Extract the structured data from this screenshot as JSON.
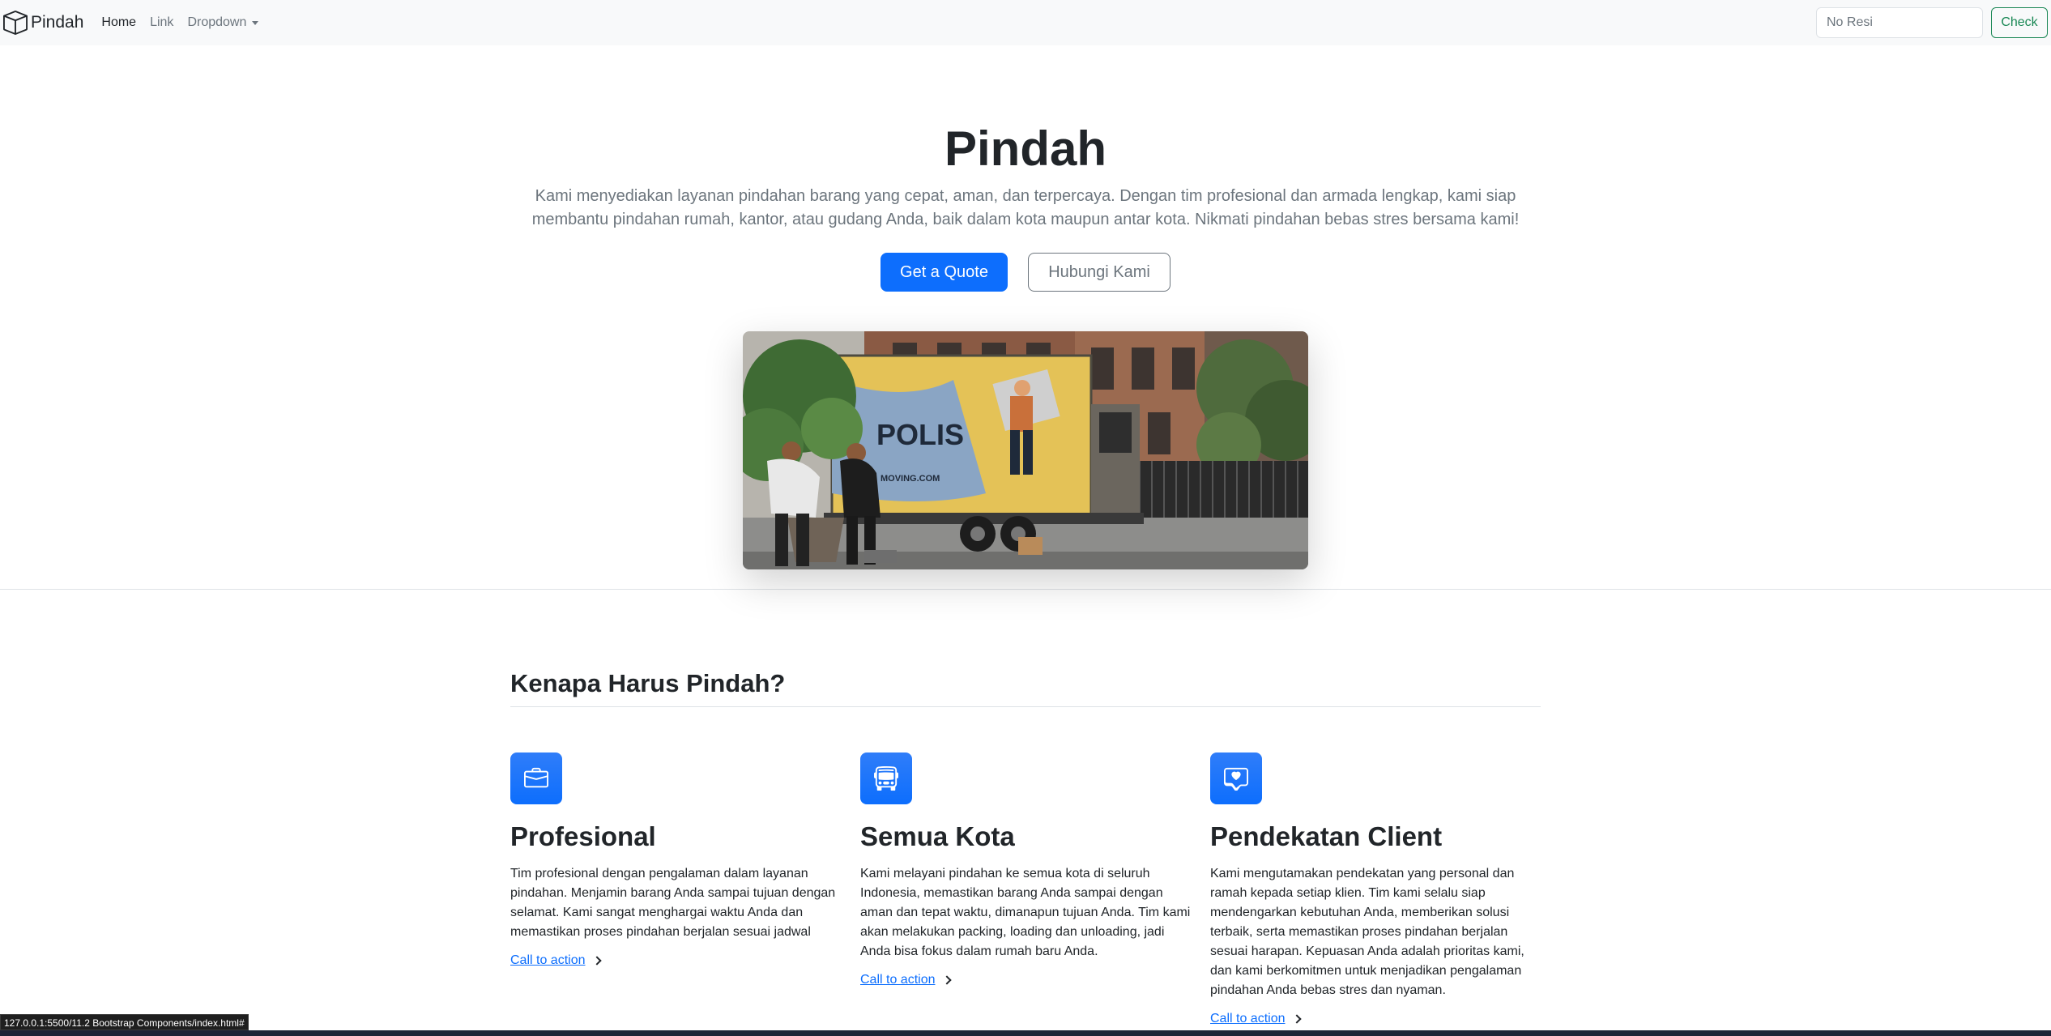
{
  "navbar": {
    "brand": "Pindah",
    "links": [
      "Home",
      "Link",
      "Dropdown"
    ],
    "search_placeholder": "No Resi",
    "check_label": "Check"
  },
  "hero": {
    "title": "Pindah",
    "lead": "Kami menyediakan layanan pindahan barang yang cepat, aman, dan terpercaya. Dengan tim profesional dan armada lengkap, kami siap membantu pindahan rumah, kantor, atau gudang Anda, baik dalam kota maupun antar kota. Nikmati pindahan bebas stres bersama kami!",
    "primary_button": "Get a Quote",
    "secondary_button": "Hubungi Kami",
    "truck_text": "POLIS",
    "truck_text_small": "MOVING.COM"
  },
  "features": {
    "title": "Kenapa Harus Pindah?",
    "items": [
      {
        "icon": "briefcase-icon",
        "title": "Profesional",
        "text": "Tim profesional dengan pengalaman dalam layanan pindahan. Menjamin barang Anda sampai tujuan dengan selamat. Kami sangat menghargai waktu Anda dan memastikan proses pindahan berjalan sesuai jadwal",
        "link": "Call to action"
      },
      {
        "icon": "bus-icon",
        "title": "Semua Kota",
        "text": "Kami melayani pindahan ke semua kota di seluruh Indonesia, memastikan barang Anda sampai dengan aman dan tepat waktu, dimanapun tujuan Anda. Tim kami akan melakukan packing, loading dan unloading, jadi Anda bisa fokus dalam rumah baru Anda.",
        "link": "Call to action"
      },
      {
        "icon": "chat-heart-icon",
        "title": "Pendekatan Client",
        "text": "Kami mengutamakan pendekatan yang personal dan ramah kepada setiap klien. Tim kami selalu siap mendengarkan kebutuhan Anda, memberikan solusi terbaik, serta memastikan proses pindahan berjalan sesuai harapan. Kepuasan Anda adalah prioritas kami, dan kami berkomitmen untuk menjadikan pengalaman pindahan Anda bebas stres dan nyaman.",
        "link": "Call to action"
      }
    ]
  },
  "status_url": "127.0.0.1:5500/11.2 Bootstrap Components/index.html#",
  "colors": {
    "primary": "#0d6efd",
    "success": "#198754",
    "secondary": "#6c757d",
    "navbar_bg": "#f8f9fa"
  }
}
